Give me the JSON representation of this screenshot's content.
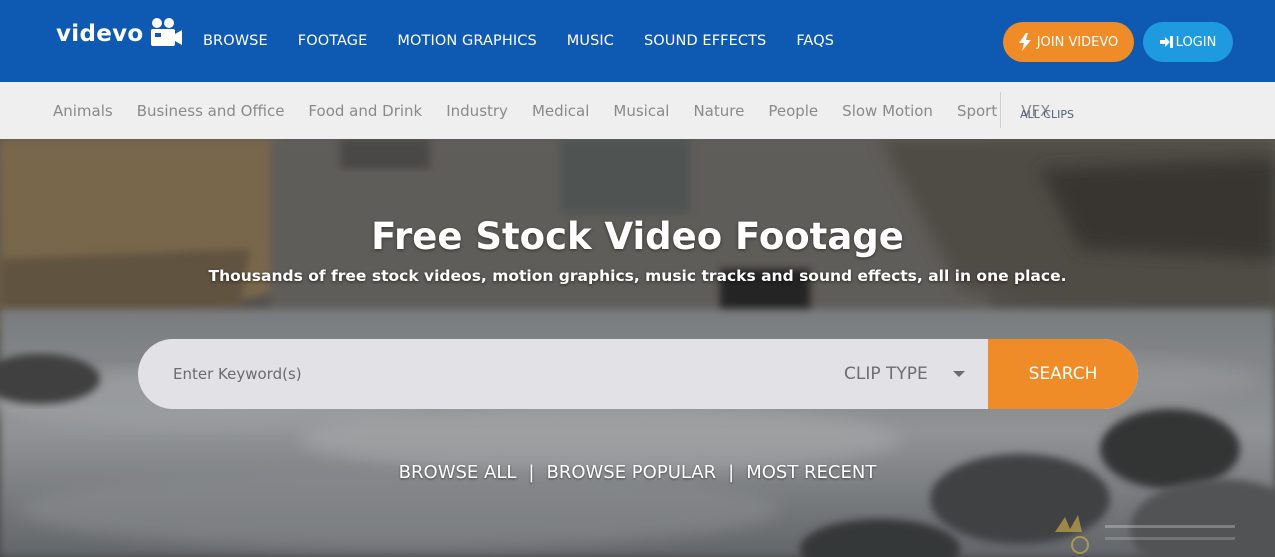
{
  "header": {
    "logo_text": "videvo",
    "nav": [
      "BROWSE",
      "FOOTAGE",
      "MOTION GRAPHICS",
      "MUSIC",
      "SOUND EFFECTS",
      "FAQS"
    ],
    "join_label": "JOIN VIDEVO",
    "login_label": "LOGIN"
  },
  "categories": {
    "items": [
      "Animals",
      "Business and Office",
      "Food and Drink",
      "Industry",
      "Medical",
      "Musical",
      "Nature",
      "People",
      "Slow Motion",
      "Sport",
      "VFX"
    ],
    "all_clips": "ALL CLIPS"
  },
  "hero": {
    "title": "Free Stock Video Footage",
    "subtitle": "Thousands of free stock videos, motion graphics, music tracks and sound effects, all in one place."
  },
  "search": {
    "placeholder": "Enter Keyword(s)",
    "clip_type": "CLIP TYPE",
    "button": "SEARCH"
  },
  "browse": {
    "all": "BROWSE ALL",
    "popular": "BROWSE POPULAR",
    "recent": "MOST RECENT",
    "separator": "|"
  },
  "colors": {
    "header_bg": "#0e5ab2",
    "join_bg": "#ef8c27",
    "login_bg": "#1e9ae0",
    "catbar_bg": "#efefef",
    "search_bg": "#e2e1e6"
  }
}
